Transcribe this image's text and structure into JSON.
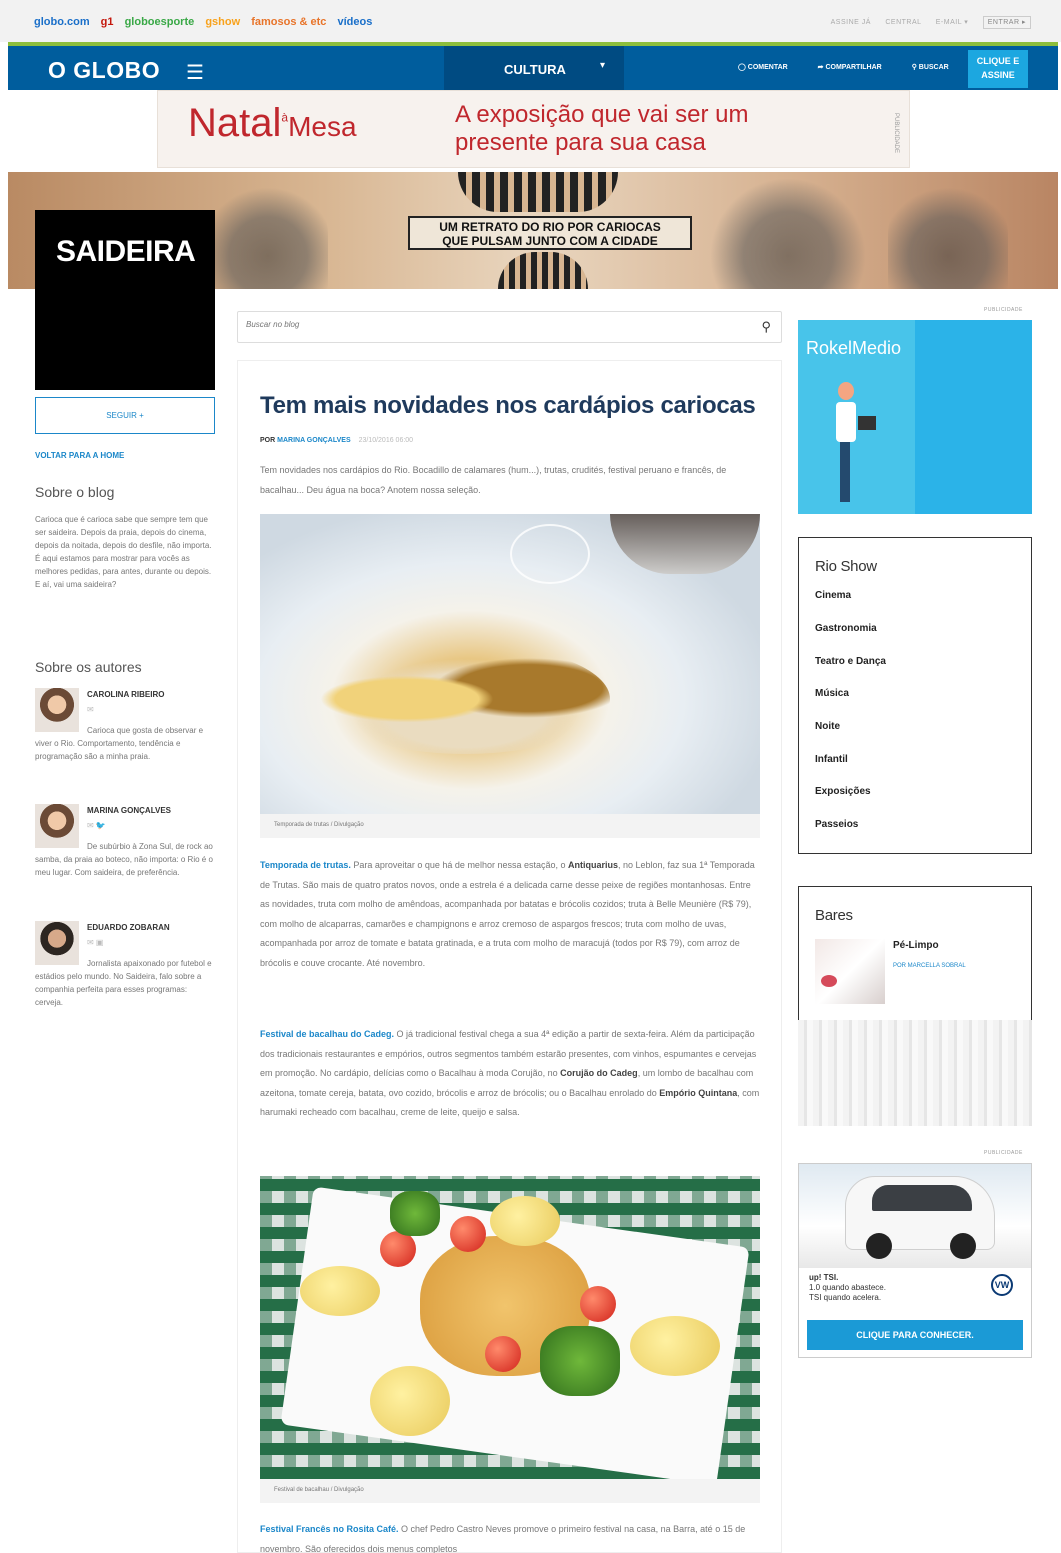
{
  "network": {
    "links": [
      {
        "label": "globo.com",
        "color": "#1a6fc9"
      },
      {
        "label": "g1",
        "color": "#c4170c"
      },
      {
        "label": "globoesporte",
        "color": "#39a846"
      },
      {
        "label": "gshow",
        "color": "#f8a21c"
      },
      {
        "label": "famosos & etc",
        "color": "#e8742a"
      },
      {
        "label": "vídeos",
        "color": "#1a6fc9"
      }
    ],
    "right": [
      "ASSINE JÁ",
      "CENTRAL",
      "E-MAIL ▾"
    ],
    "entrar": "ENTRAR ▸"
  },
  "header": {
    "logo": "O GLOBO",
    "menu_icon": "☰",
    "section": "CULTURA",
    "section_chevron": "▾",
    "tools": {
      "comment": "COMENTAR",
      "share": "COMPARTILHAR",
      "search": "BUSCAR"
    },
    "assine_line1": "CLIQUE E",
    "assine_line2": "ASSINE",
    "brand_blue": "#005d9d",
    "accent_green": "#8dbe3c"
  },
  "ad_banner": {
    "brand": "Natal",
    "brand_small": "à",
    "brand_mesa": "Mesa",
    "line1": "A exposição que vai ser um",
    "line2": "presente para sua casa",
    "tag": "PUBLICIDADE"
  },
  "hero": {
    "line1": "UM RETRATO DO RIO POR CARIOCAS",
    "line2": "QUE PULSAM JUNTO COM A CIDADE"
  },
  "sidebar": {
    "blog_name": "SAIDEIRA",
    "follow": "SEGUIR +",
    "back": "VOLTAR PARA A HOME",
    "about_title": "Sobre o blog",
    "about_text": "Carioca que é carioca sabe que sempre tem que ser saideira. Depois da praia, depois do cinema, depois da noitada, depois do desfile, não importa. É aqui estamos para mostrar para vocês as melhores pedidas, para antes, durante ou depois. E aí, vai uma saideira?",
    "authors_title": "Sobre os autores",
    "authors": [
      {
        "name": "CAROLINA RIBEIRO",
        "social": "✉",
        "bio": "Carioca que gosta de observar e viver o Rio. Comportamento, tendência e programação são a minha praia."
      },
      {
        "name": "MARINA GONÇALVES",
        "social": "✉  🐦",
        "bio": "De subúrbio à Zona Sul, de rock ao samba, da praia ao boteco, não importa: o Rio é o meu lugar. Com saideira, de preferência."
      },
      {
        "name": "EDUARDO ZOBARAN",
        "social": "✉  ▣",
        "bio": "Jornalista apaixonado por futebol e estádios pelo mundo. No Saideira, falo sobre a companhia perfeita para esses programas: cerveja."
      }
    ]
  },
  "search": {
    "placeholder": "Buscar no blog",
    "icon": "search-icon"
  },
  "article": {
    "title": "Tem mais novidades nos cardápios cariocas",
    "by": "POR",
    "author": "MARINA GONÇALVES",
    "date": "23/10/2016 06:00",
    "lede": "Tem novidades nos cardápios do Rio. Bocadillo de calamares (hum...), trutas, crudités, festival peruano e francês, de bacalhau... Deu água na boca? Anotem nossa seleção.",
    "caption1": "Temporada de trutas / Divulgação",
    "p1_key": "Temporada de trutas.",
    "p1_a": " Para aproveitar o que há de melhor nessa estação, o ",
    "p1_place": "Antiquarius",
    "p1_b": ", no Leblon, faz sua 1ª Temporada de Trutas. São mais de quatro pratos novos, onde a estrela é a delicada carne desse peixe de regiões montanhosas. Entre as novidades, truta com molho de amêndoas, acompanhada por batatas e brócolis cozidos; truta à Belle Meunière (R$ 79), com molho de alcaparras, camarões e champignons e arroz cremoso de aspargos frescos; truta com molho de uvas, acompanhada por arroz de tomate e batata gratinada, e a truta com molho de maracujá (todos por R$ 79), com arroz de brócolis e couve crocante. Até novembro.",
    "p2_key": "Festival de bacalhau do Cadeg.",
    "p2_a": " O já tradicional festival chega a sua 4ª edição a partir de sexta-feira. Além da participação dos tradicionais restaurantes e empórios, outros segmentos também estarão presentes, com vinhos, espumantes e cervejas em promoção. No cardápio, delícias como o Bacalhau à moda Corujão, no ",
    "p2_place1": "Corujão do Cadeg",
    "p2_b": ", um lombo de bacalhau com azeitona, tomate cereja, batata, ovo cozido, brócolis e arroz de brócolis; ou o Bacalhau enrolado do ",
    "p2_place2": "Empório Quintana",
    "p2_c": ", com harumaki recheado com bacalhau, creme de leite, queijo e salsa.",
    "caption2": "Festival de bacalhau / Divulgação",
    "p3_key": "Festival Francês no Rosita Café.",
    "p3_a": " O chef Pedro Castro Neves promove o primeiro festival na casa, na Barra, até o 15 de novembro. São oferecidos dois menus completos"
  },
  "right": {
    "pub_label": "PUBLICIDADE",
    "rocket_logo": "RokelMedio",
    "rioshow": {
      "title": "Rio Show",
      "items": [
        "Cinema",
        "Gastronomia",
        "Teatro e Dança",
        "Música",
        "Noite",
        "Infantil",
        "Exposições",
        "Passeios"
      ]
    },
    "bares": {
      "title": "Bares",
      "item_title": "Pé-Limpo",
      "item_by": "POR MARCELLA SOBRAL"
    },
    "vw": {
      "line1": "up! TSI.",
      "line2": "1.0 quando abastece.",
      "line3": "TSI quando acelera.",
      "logo": "VW",
      "cta": "CLIQUE PARA CONHECER."
    }
  }
}
